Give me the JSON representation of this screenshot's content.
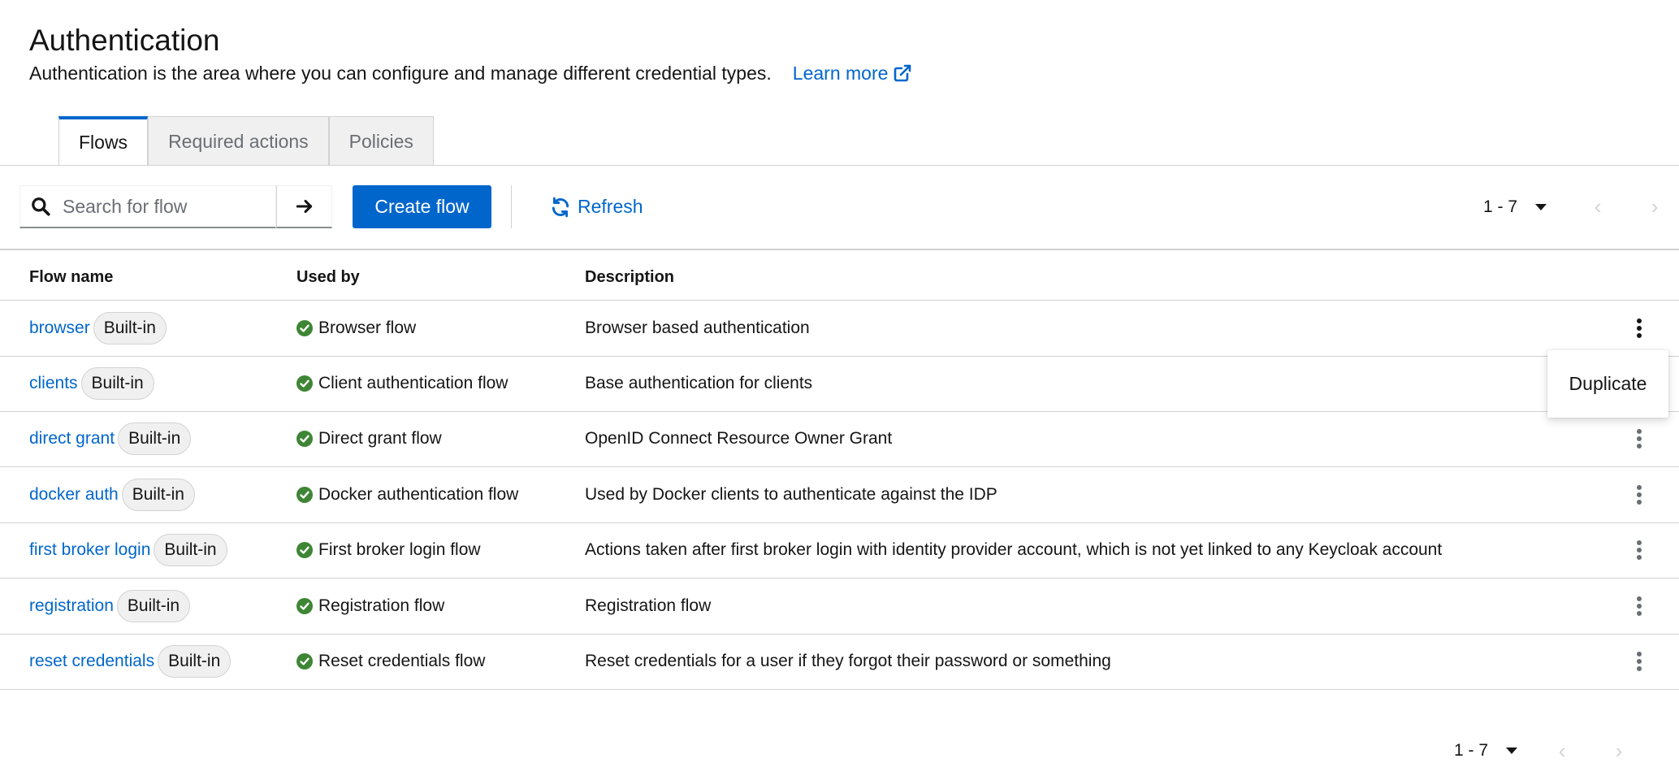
{
  "header": {
    "title": "Authentication",
    "description": "Authentication is the area where you can configure and manage different credential types.",
    "learn_more": "Learn more"
  },
  "tabs": [
    {
      "label": "Flows",
      "active": true
    },
    {
      "label": "Required actions",
      "active": false
    },
    {
      "label": "Policies",
      "active": false
    }
  ],
  "toolbar": {
    "search_placeholder": "Search for flow",
    "create_label": "Create flow",
    "refresh_label": "Refresh",
    "pagination_label": "1 - 7"
  },
  "table": {
    "columns": [
      "Flow name",
      "Used by",
      "Description"
    ],
    "rows": [
      {
        "name": "browser",
        "badge": "Built-in",
        "used_by": "Browser flow",
        "description": "Browser based authentication"
      },
      {
        "name": "clients",
        "badge": "Built-in",
        "used_by": "Client authentication flow",
        "description": "Base authentication for clients"
      },
      {
        "name": "direct grant",
        "badge": "Built-in",
        "used_by": "Direct grant flow",
        "description": "OpenID Connect Resource Owner Grant"
      },
      {
        "name": "docker auth",
        "badge": "Built-in",
        "used_by": "Docker authentication flow",
        "description": "Used by Docker clients to authenticate against the IDP"
      },
      {
        "name": "first broker login",
        "badge": "Built-in",
        "used_by": "First broker login flow",
        "description": "Actions taken after first broker login with identity provider account, which is not yet linked to any Keycloak account"
      },
      {
        "name": "registration",
        "badge": "Built-in",
        "used_by": "Registration flow",
        "description": "Registration flow"
      },
      {
        "name": "reset credentials",
        "badge": "Built-in",
        "used_by": "Reset credentials flow",
        "description": "Reset credentials for a user if they forgot their password or something"
      }
    ]
  },
  "row_menu": {
    "item": "Duplicate"
  },
  "footer": {
    "pagination_label": "1 - 7"
  },
  "colors": {
    "link": "#0066cc",
    "primary": "#0066cc",
    "success": "#3e8635",
    "border": "#d2d2d2"
  }
}
